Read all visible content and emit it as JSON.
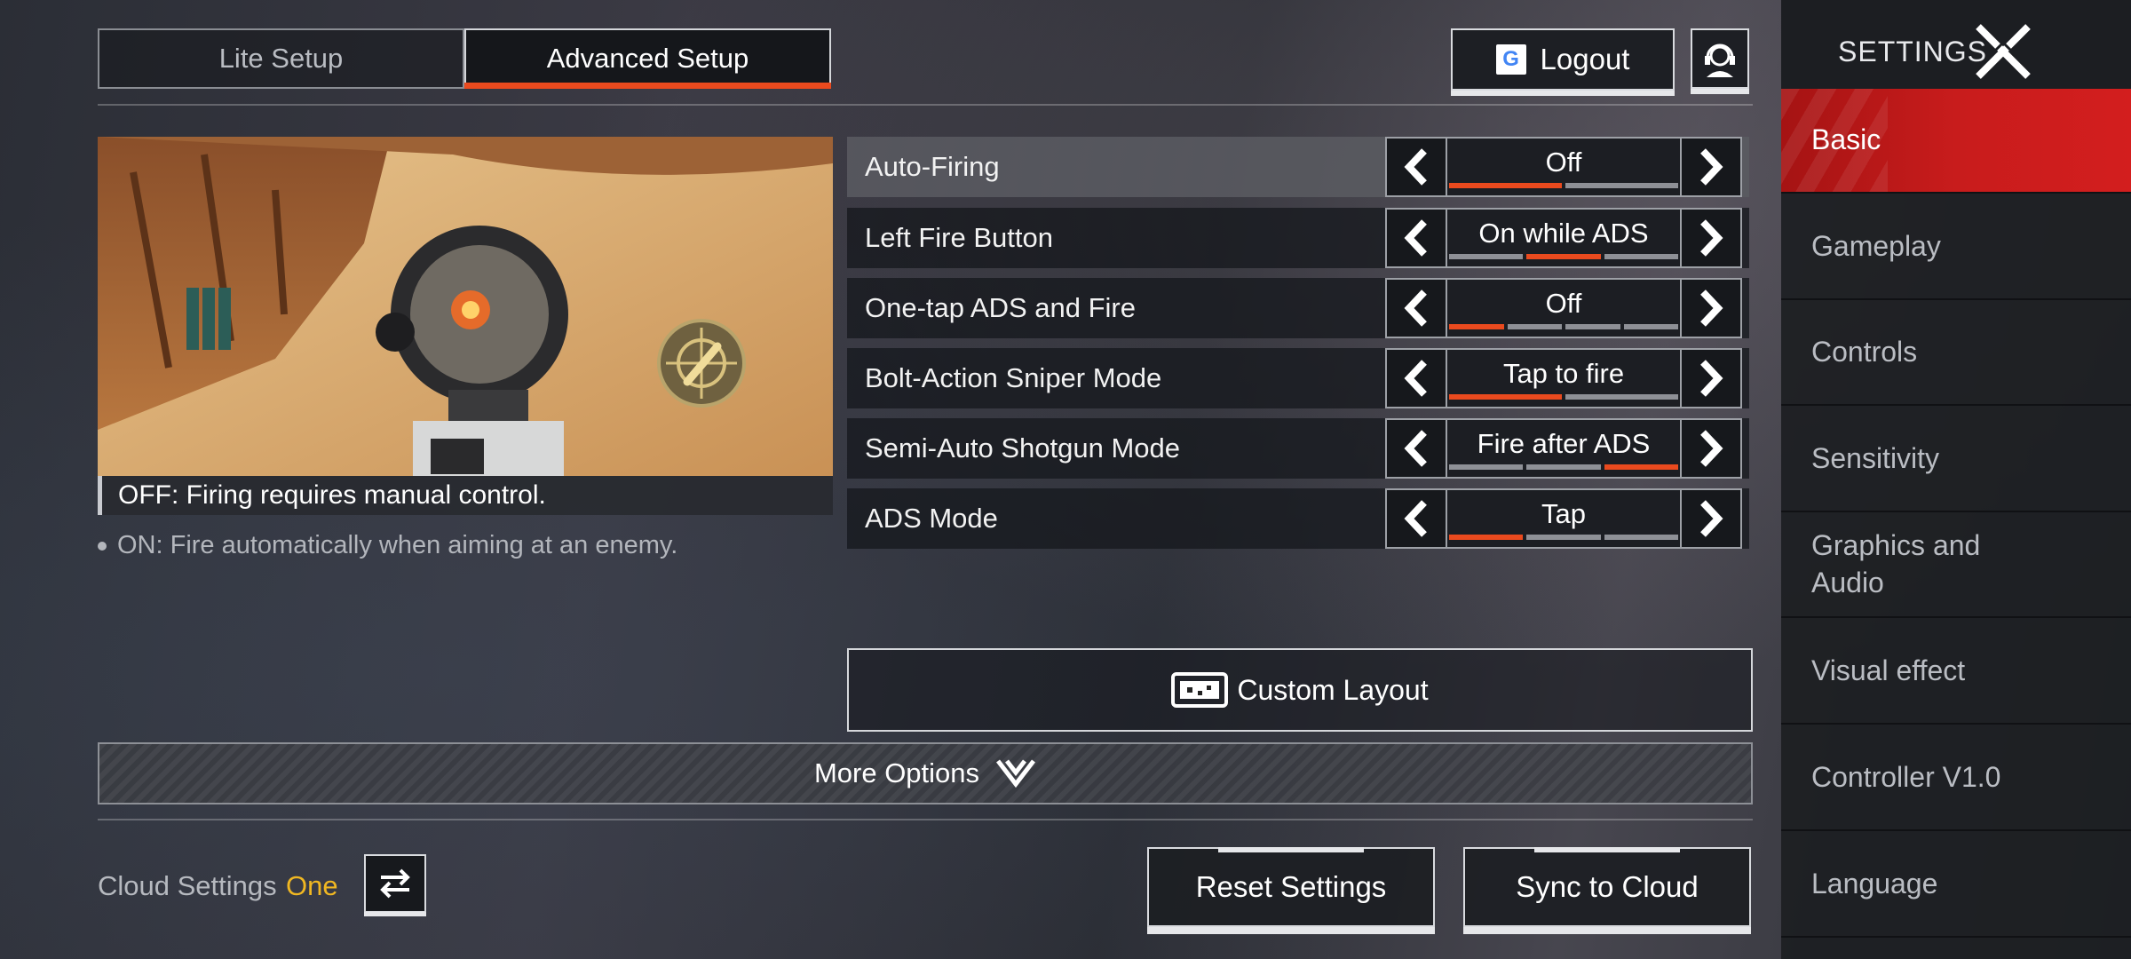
{
  "tabs": [
    {
      "label": "Lite Setup",
      "active": false
    },
    {
      "label": "Advanced Setup",
      "active": true
    }
  ],
  "header": {
    "logout_label": "Logout",
    "google_icon": "G"
  },
  "preview": {
    "caption": "OFF: Firing requires manual control.",
    "note": "ON: Fire automatically when aiming at an enemy."
  },
  "settings": [
    {
      "label": "Auto-Firing",
      "value": "Off",
      "options": 2,
      "selected": 0
    },
    {
      "label": "Left Fire Button",
      "value": "On while ADS",
      "options": 3,
      "selected": 1
    },
    {
      "label": "One-tap ADS and Fire",
      "value": "Off",
      "options": 4,
      "selected": 0
    },
    {
      "label": "Bolt-Action Sniper Mode",
      "value": "Tap to fire",
      "options": 2,
      "selected": 0
    },
    {
      "label": "Semi-Auto Shotgun Mode",
      "value": "Fire after ADS",
      "options": 3,
      "selected": 2
    },
    {
      "label": "ADS Mode",
      "value": "Tap",
      "options": 3,
      "selected": 0
    }
  ],
  "custom_layout_label": "Custom Layout",
  "more_options_label": "More Options",
  "cloud": {
    "label": "Cloud Settings",
    "value": "One"
  },
  "buttons": {
    "reset": "Reset Settings",
    "sync": "Sync to Cloud"
  },
  "sidebar": {
    "title": "SETTINGS",
    "items": [
      {
        "label": "Basic",
        "active": true
      },
      {
        "label": "Gameplay",
        "active": false
      },
      {
        "label": "Controls",
        "active": false
      },
      {
        "label": "Sensitivity",
        "active": false
      },
      {
        "label": "Graphics and Audio",
        "active": false
      },
      {
        "label": "Visual effect",
        "active": false
      },
      {
        "label": "Controller V1.0",
        "active": false
      },
      {
        "label": "Language",
        "active": false
      }
    ]
  },
  "colors": {
    "accent": "#ea4a1e",
    "sidebar_active": "#c81c1c",
    "cloud_value": "#f0b722"
  }
}
